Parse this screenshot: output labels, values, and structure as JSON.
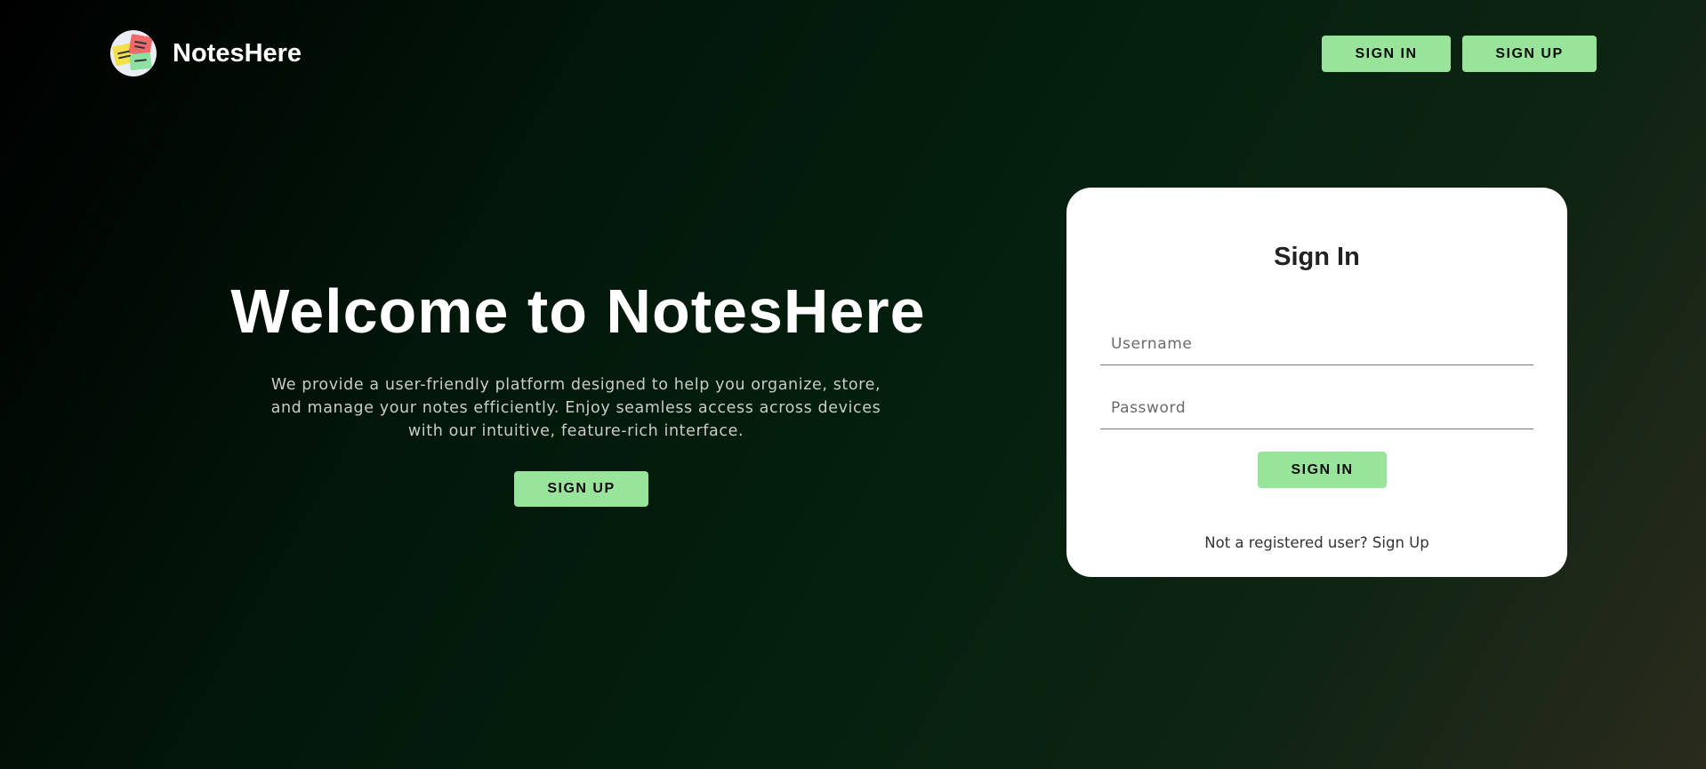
{
  "header": {
    "brand_name": "NotesHere",
    "logo_icon": "sticky-notes-icon",
    "sign_in_label": "SIGN IN",
    "sign_up_label": "SIGN UP"
  },
  "hero": {
    "title": "Welcome to NotesHere",
    "description": "We provide a user-friendly platform designed to help you organize, store, and manage your notes efficiently. Enjoy seamless access across devices with our intuitive, feature-rich interface.",
    "sign_up_label": "SIGN UP"
  },
  "sign_in_card": {
    "title": "Sign In",
    "username_placeholder": "Username",
    "username_value": "",
    "password_placeholder": "Password",
    "password_value": "",
    "submit_label": "SIGN IN",
    "footer_text": "Not a registered user?",
    "footer_link": "Sign Up"
  },
  "colors": {
    "accent_button": "#98e49a",
    "card_background": "#ffffff",
    "page_background_start": "#000000",
    "page_background_end": "#2a2b1d"
  }
}
